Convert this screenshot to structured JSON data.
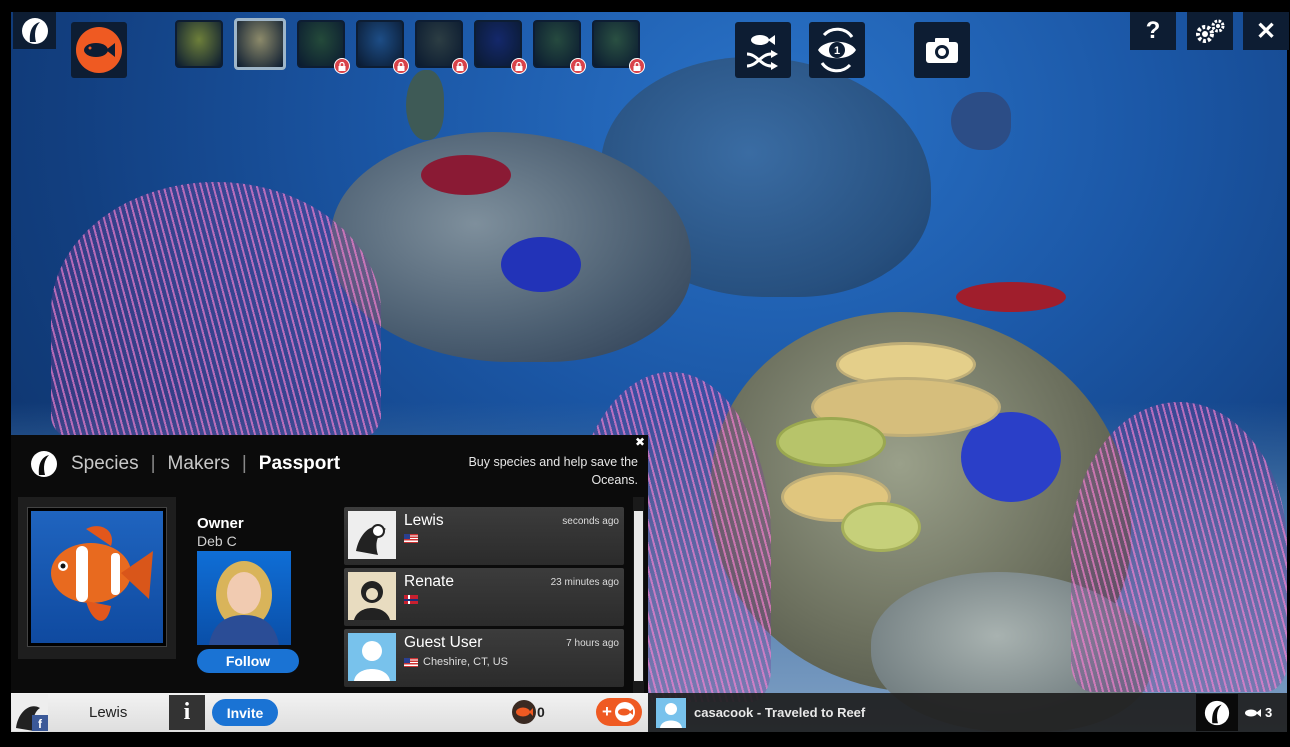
{
  "toolbar": {
    "scenes": [
      {
        "name": "scene-sunlight",
        "locked": false,
        "selected": false,
        "color": "#6d7f3a"
      },
      {
        "name": "scene-reef",
        "locked": false,
        "selected": true,
        "color": "#8c8a6a"
      },
      {
        "name": "scene-kelp",
        "locked": true,
        "selected": false,
        "color": "#244a3a"
      },
      {
        "name": "scene-deep-blue",
        "locked": true,
        "selected": false,
        "color": "#1d4d86"
      },
      {
        "name": "scene-vent",
        "locked": true,
        "selected": false,
        "color": "#2c3d43"
      },
      {
        "name": "scene-abyss",
        "locked": true,
        "selected": false,
        "color": "#14286b"
      },
      {
        "name": "scene-cave",
        "locked": true,
        "selected": false,
        "color": "#264a3f"
      },
      {
        "name": "scene-wreck",
        "locked": true,
        "selected": false,
        "color": "#2a5042"
      }
    ],
    "help_label": "?",
    "close_label": "✕",
    "icons": [
      "logo-icon",
      "fish-icon",
      "shuffle-fish-icon",
      "view-rotate-icon",
      "camera-icon",
      "help-icon",
      "settings-icon",
      "close-icon"
    ]
  },
  "panel": {
    "tabs": [
      "Species",
      "Makers",
      "Passport"
    ],
    "separator": "|",
    "active_tab": "Passport",
    "promo_text": "Buy species and help save the Oceans.",
    "close_label": "✖",
    "owner_label": "Owner",
    "owner_name": "Deb C",
    "follow_label": "Follow",
    "visitors": [
      {
        "name": "Lewis",
        "time": "seconds ago",
        "location": ""
      },
      {
        "name": "Renate",
        "time": "23 minutes ago",
        "location": ""
      },
      {
        "name": "Guest User",
        "time": "7 hours ago",
        "location": "Cheshire, CT, US"
      }
    ]
  },
  "bottom_bar": {
    "user_name": "Lewis",
    "info_label": "i",
    "invite_label": "Invite",
    "coins": "0",
    "add_label": "+",
    "feed_text": "casacook - Traveled to Reef",
    "fish_count": "3"
  },
  "colors": {
    "accent": "#ef5a22",
    "button_blue": "#1a73d4",
    "toolbar": "#0d1d33"
  }
}
